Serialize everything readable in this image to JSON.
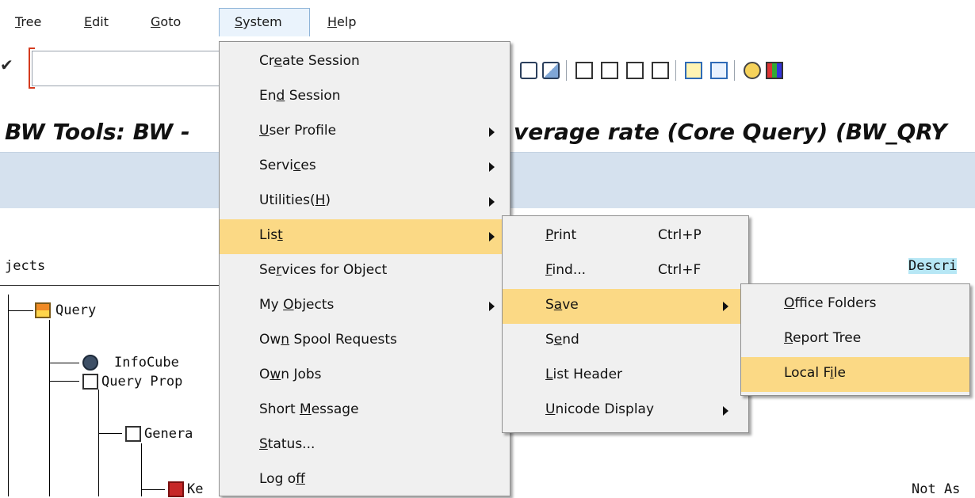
{
  "menubar": {
    "items": [
      {
        "text": "Tree",
        "u": "T",
        "rest": "ree"
      },
      {
        "text": "Edit",
        "u": "E",
        "rest": "dit"
      },
      {
        "text": "Goto",
        "u": "G",
        "rest": "oto"
      },
      {
        "text": "System",
        "u": "S",
        "rest": "ystem"
      },
      {
        "text": "Help",
        "u": "H",
        "rest": "elp"
      }
    ]
  },
  "title": {
    "left": "BW Tools: BW - ",
    "right": "verage rate (Core Query) (BW_QRY"
  },
  "tree": {
    "header_left": "jects",
    "header_right": "Descri",
    "nodes": [
      "Query",
      "InfoCube",
      "Query Prop",
      "Genera",
      "Ke"
    ],
    "right_text_bottom": "Not As"
  },
  "system_menu": {
    "items": [
      {
        "pre": "Cr",
        "u": "e",
        "post": "ate Session"
      },
      {
        "pre": "En",
        "u": "d",
        "post": " Session"
      },
      {
        "pre": "",
        "u": "U",
        "post": "ser Profile"
      },
      {
        "pre": "Servi",
        "u": "c",
        "post": "es"
      },
      {
        "pre": "Utilities(",
        "u": "H",
        "post": ")"
      },
      {
        "pre": "Lis",
        "u": "t",
        "post": ""
      },
      {
        "pre": "Se",
        "u": "r",
        "post": "vices for Object"
      },
      {
        "pre": "My ",
        "u": "O",
        "post": "bjects"
      },
      {
        "pre": "Ow",
        "u": "n",
        "post": " Spool Requests"
      },
      {
        "pre": "O",
        "u": "w",
        "post": "n Jobs"
      },
      {
        "pre": "Short ",
        "u": "M",
        "post": "essage"
      },
      {
        "pre": "",
        "u": "S",
        "post": "tatus..."
      },
      {
        "pre": "Log o",
        "u": "f",
        "post": "f"
      }
    ]
  },
  "list_menu": {
    "items": [
      {
        "pre": "",
        "u": "P",
        "post": "rint",
        "shortcut": "Ctrl+P"
      },
      {
        "pre": "",
        "u": "F",
        "post": "ind...",
        "shortcut": "Ctrl+F"
      },
      {
        "pre": "S",
        "u": "a",
        "post": "ve",
        "shortcut": ""
      },
      {
        "pre": "S",
        "u": "e",
        "post": "nd",
        "shortcut": ""
      },
      {
        "pre": "",
        "u": "L",
        "post": "ist Header",
        "shortcut": ""
      },
      {
        "pre": "",
        "u": "U",
        "post": "nicode Display",
        "shortcut": ""
      }
    ]
  },
  "save_menu": {
    "items": [
      {
        "pre": "",
        "u": "O",
        "post": "ffice Folders"
      },
      {
        "pre": "",
        "u": "R",
        "post": "eport Tree"
      },
      {
        "pre": "Local F",
        "u": "i",
        "post": "le"
      }
    ]
  },
  "colors": {
    "menu_bg": "#f0f0f0",
    "menu_highlight": "#fbd985",
    "app_toolbar": "#d5e1ee",
    "description_hl": "#b7e7f5",
    "cmd_bracket": "#d43b1f"
  },
  "icons": {
    "toolbar": [
      "check-icon",
      "find-icon",
      "find-next-icon",
      "first-page-icon",
      "previous-page-icon",
      "next-page-icon",
      "last-page-icon",
      "create-session-icon",
      "shortcut-icon",
      "help-icon",
      "customize-layout-icon"
    ],
    "tree": [
      "query-icon",
      "infocube-icon",
      "properties-icon",
      "general-icon",
      "keyfigure-icon"
    ]
  }
}
